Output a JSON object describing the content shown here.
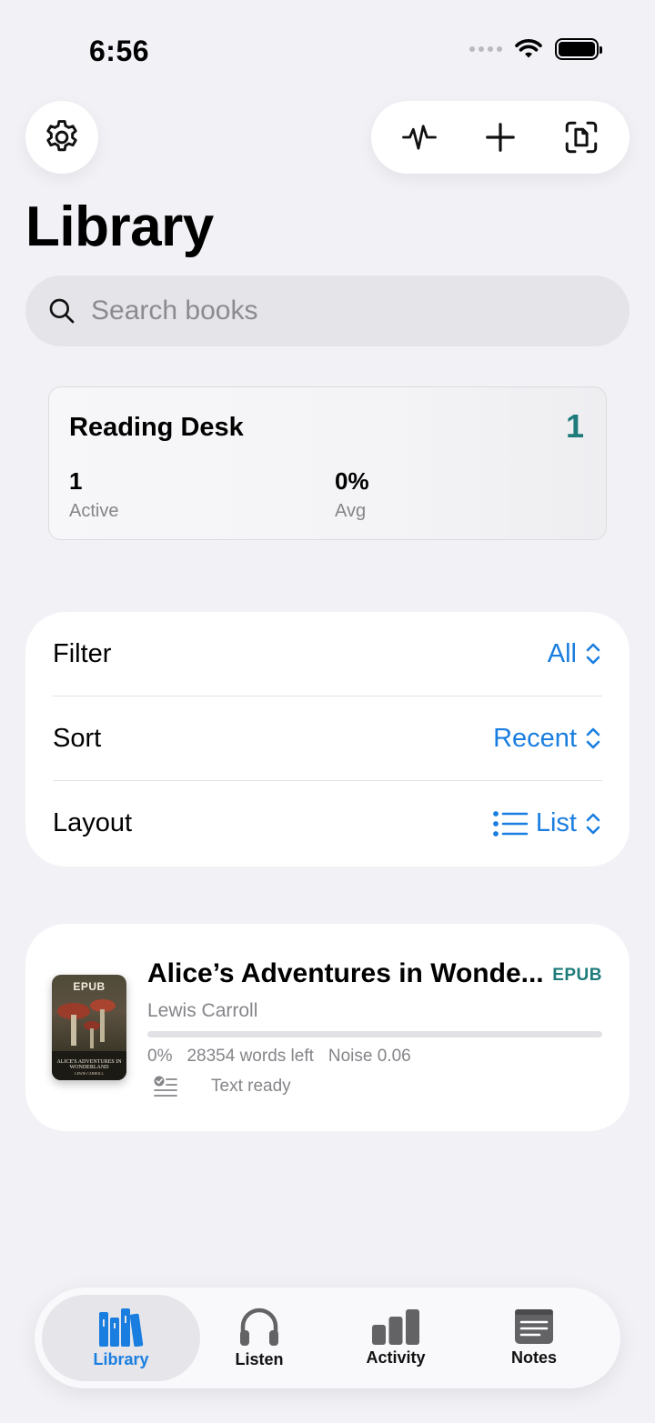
{
  "status_bar": {
    "time": "6:56"
  },
  "header": {
    "settings_icon": "gear-icon",
    "toolbar_icons": [
      "activity-pulse-icon",
      "plus-icon",
      "scan-document-icon"
    ],
    "title": "Library"
  },
  "search": {
    "placeholder": "Search books",
    "value": ""
  },
  "reading_desk": {
    "title": "Reading Desk",
    "count": "1",
    "stats": [
      {
        "value": "1",
        "label": "Active"
      },
      {
        "value": "0%",
        "label": "Avg"
      }
    ]
  },
  "settings": {
    "filter": {
      "label": "Filter",
      "value": "All"
    },
    "sort": {
      "label": "Sort",
      "value": "Recent"
    },
    "layout": {
      "label": "Layout",
      "value": "List"
    }
  },
  "book": {
    "cover_tag": "EPUB",
    "cover_title": "ALICE'S ADVENTURES IN WONDERLAND",
    "cover_author": "LEWIS CARROLL",
    "title": "Alice’s Adventures in Wonde...",
    "format": "EPUB",
    "author": "Lewis Carroll",
    "progress_fraction": 0,
    "progress": "0%",
    "words_left": "28354 words left",
    "noise": "Noise 0.06",
    "status": "Text ready"
  },
  "tabs": [
    {
      "label": "Library",
      "icon": "books-icon",
      "active": true
    },
    {
      "label": "Listen",
      "icon": "headphones-icon",
      "active": false
    },
    {
      "label": "Activity",
      "icon": "bar-chart-icon",
      "active": false
    },
    {
      "label": "Notes",
      "icon": "note-icon",
      "active": false
    }
  ],
  "colors": {
    "accent": "#1a7ee0",
    "teal": "#1d7b7b",
    "background": "#f1f1f6"
  }
}
